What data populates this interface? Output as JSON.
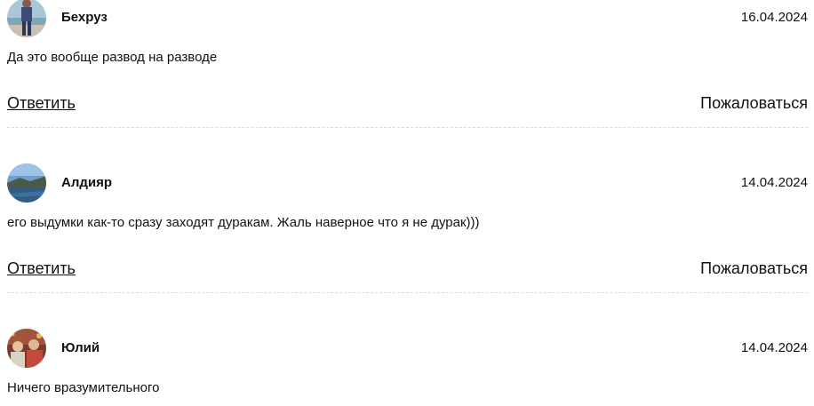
{
  "comments": [
    {
      "author": "Бехруз",
      "date": "16.04.2024",
      "text": "Да это вообще развод на разводе",
      "reply_label": "Ответить",
      "report_label": "Пожаловаться"
    },
    {
      "author": "Алдияр",
      "date": "14.04.2024",
      "text": "его выдумки как-то сразу заходят дуракам. Жаль наверное что я не дурак)))",
      "reply_label": "Ответить",
      "report_label": "Пожаловаться"
    },
    {
      "author": "Юлий",
      "date": "14.04.2024",
      "text": "Ничего вразумительного"
    }
  ]
}
